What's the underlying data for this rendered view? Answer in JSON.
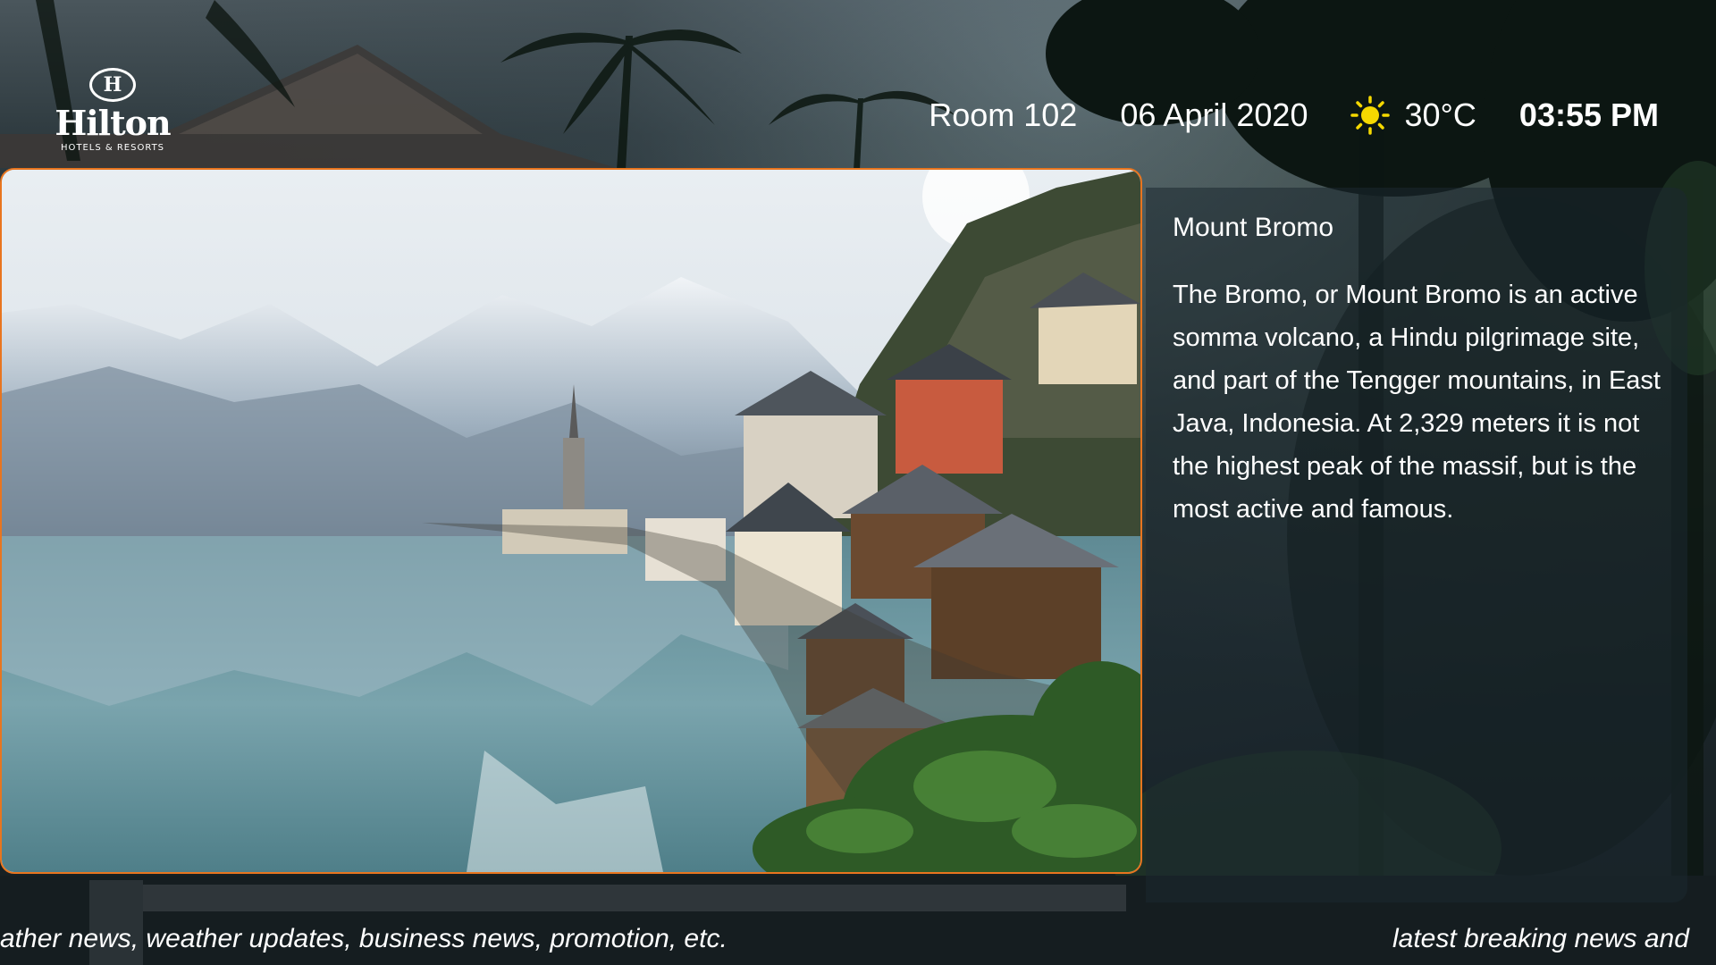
{
  "brand": {
    "name": "Hilton",
    "tagline": "HOTELS & RESORTS",
    "mark": "H"
  },
  "header": {
    "room": "Room 102",
    "date": "06 April 2020",
    "weather_icon": "sun-icon",
    "temperature": "30°C",
    "time": "03:55 PM"
  },
  "feature": {
    "image": "lakeside-village-mountains",
    "title": "Mount Bromo",
    "description": "The Bromo, or Mount Bromo is an active somma volcano, a Hindu pilgrimage site, and part of the Tengger mountains, in East Java, Indonesia. At 2,329 meters it is not the highest peak of the massif, but is the most active and famous."
  },
  "ticker": {
    "segment_1": "ather news, weather updates, business news, promotion, etc.",
    "segment_2": "latest breaking news and"
  },
  "colors": {
    "frame_border": "#e8751f",
    "sun": "#f5d800",
    "text": "#ffffff"
  }
}
